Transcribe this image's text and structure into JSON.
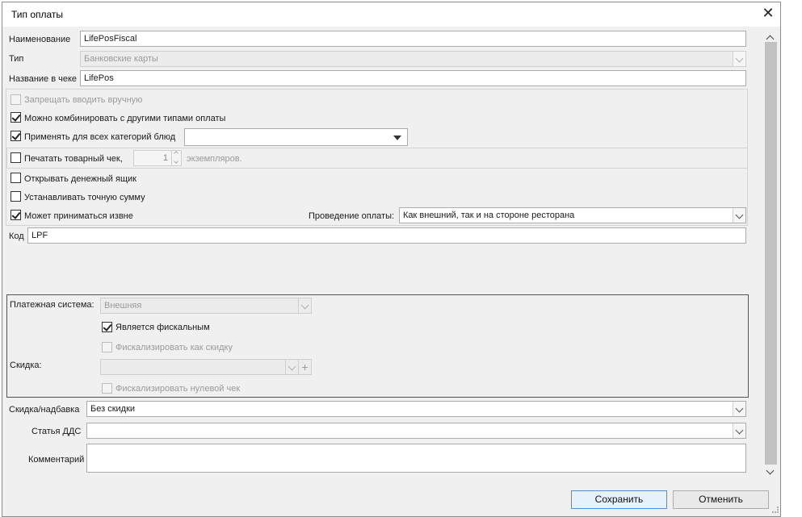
{
  "window": {
    "title": "Тип оплаты",
    "close_icon": "close-icon"
  },
  "fields": {
    "name": {
      "label": "Наименование",
      "value": "LifePosFiscal"
    },
    "type": {
      "label": "Тип",
      "value": "Банковские карты"
    },
    "receipt_name": {
      "label": "Название в чеке",
      "value": "LifePos"
    }
  },
  "options": {
    "forbid_manual": {
      "label": "Запрещать вводить вручную",
      "checked": false,
      "enabled": false
    },
    "combine": {
      "label": "Можно комбинировать с другими типами оплаты",
      "checked": true
    },
    "all_categories": {
      "label": "Применять для всех категорий блюд",
      "checked": true,
      "dropdown_value": ""
    },
    "print_receipt": {
      "label": "Печатать товарный чек,",
      "checked": false,
      "copies": "1",
      "copies_suffix": "экземпляров."
    },
    "open_drawer": {
      "label": "Открывать денежный ящик",
      "checked": false
    },
    "exact_sum": {
      "label": "Устанавливать точную сумму",
      "checked": false
    },
    "external": {
      "label": "Может приниматься извне",
      "checked": true
    },
    "processing": {
      "label": "Проведение оплаты:",
      "value": "Как внешний, так и на стороне ресторана"
    }
  },
  "code": {
    "label": "Код",
    "value": "LPF"
  },
  "payment_system": {
    "label": "Платежная система:",
    "value": "Внешняя",
    "is_fiscal": {
      "label": "Является фискальным",
      "checked": true
    },
    "fiscalize_discount": {
      "label": "Фискализировать как скидку",
      "checked": false
    },
    "discount_label": "Скидка:",
    "discount_value": "",
    "fiscalize_zero": {
      "label": "Фискализировать нулевой чек",
      "checked": false
    }
  },
  "bottom": {
    "discount_markup": {
      "label": "Скидка/надбавка",
      "value": "Без скидки"
    },
    "dds_article": {
      "label": "Статья ДДС",
      "value": ""
    },
    "comment": {
      "label": "Комментарий",
      "value": ""
    }
  },
  "buttons": {
    "save": "Сохранить",
    "cancel": "Отменить"
  },
  "colors": {
    "dialog_bg": "#f0f0f0",
    "accent_border": "#4d90d8",
    "primary_button_bg": "#e5f1fb"
  }
}
